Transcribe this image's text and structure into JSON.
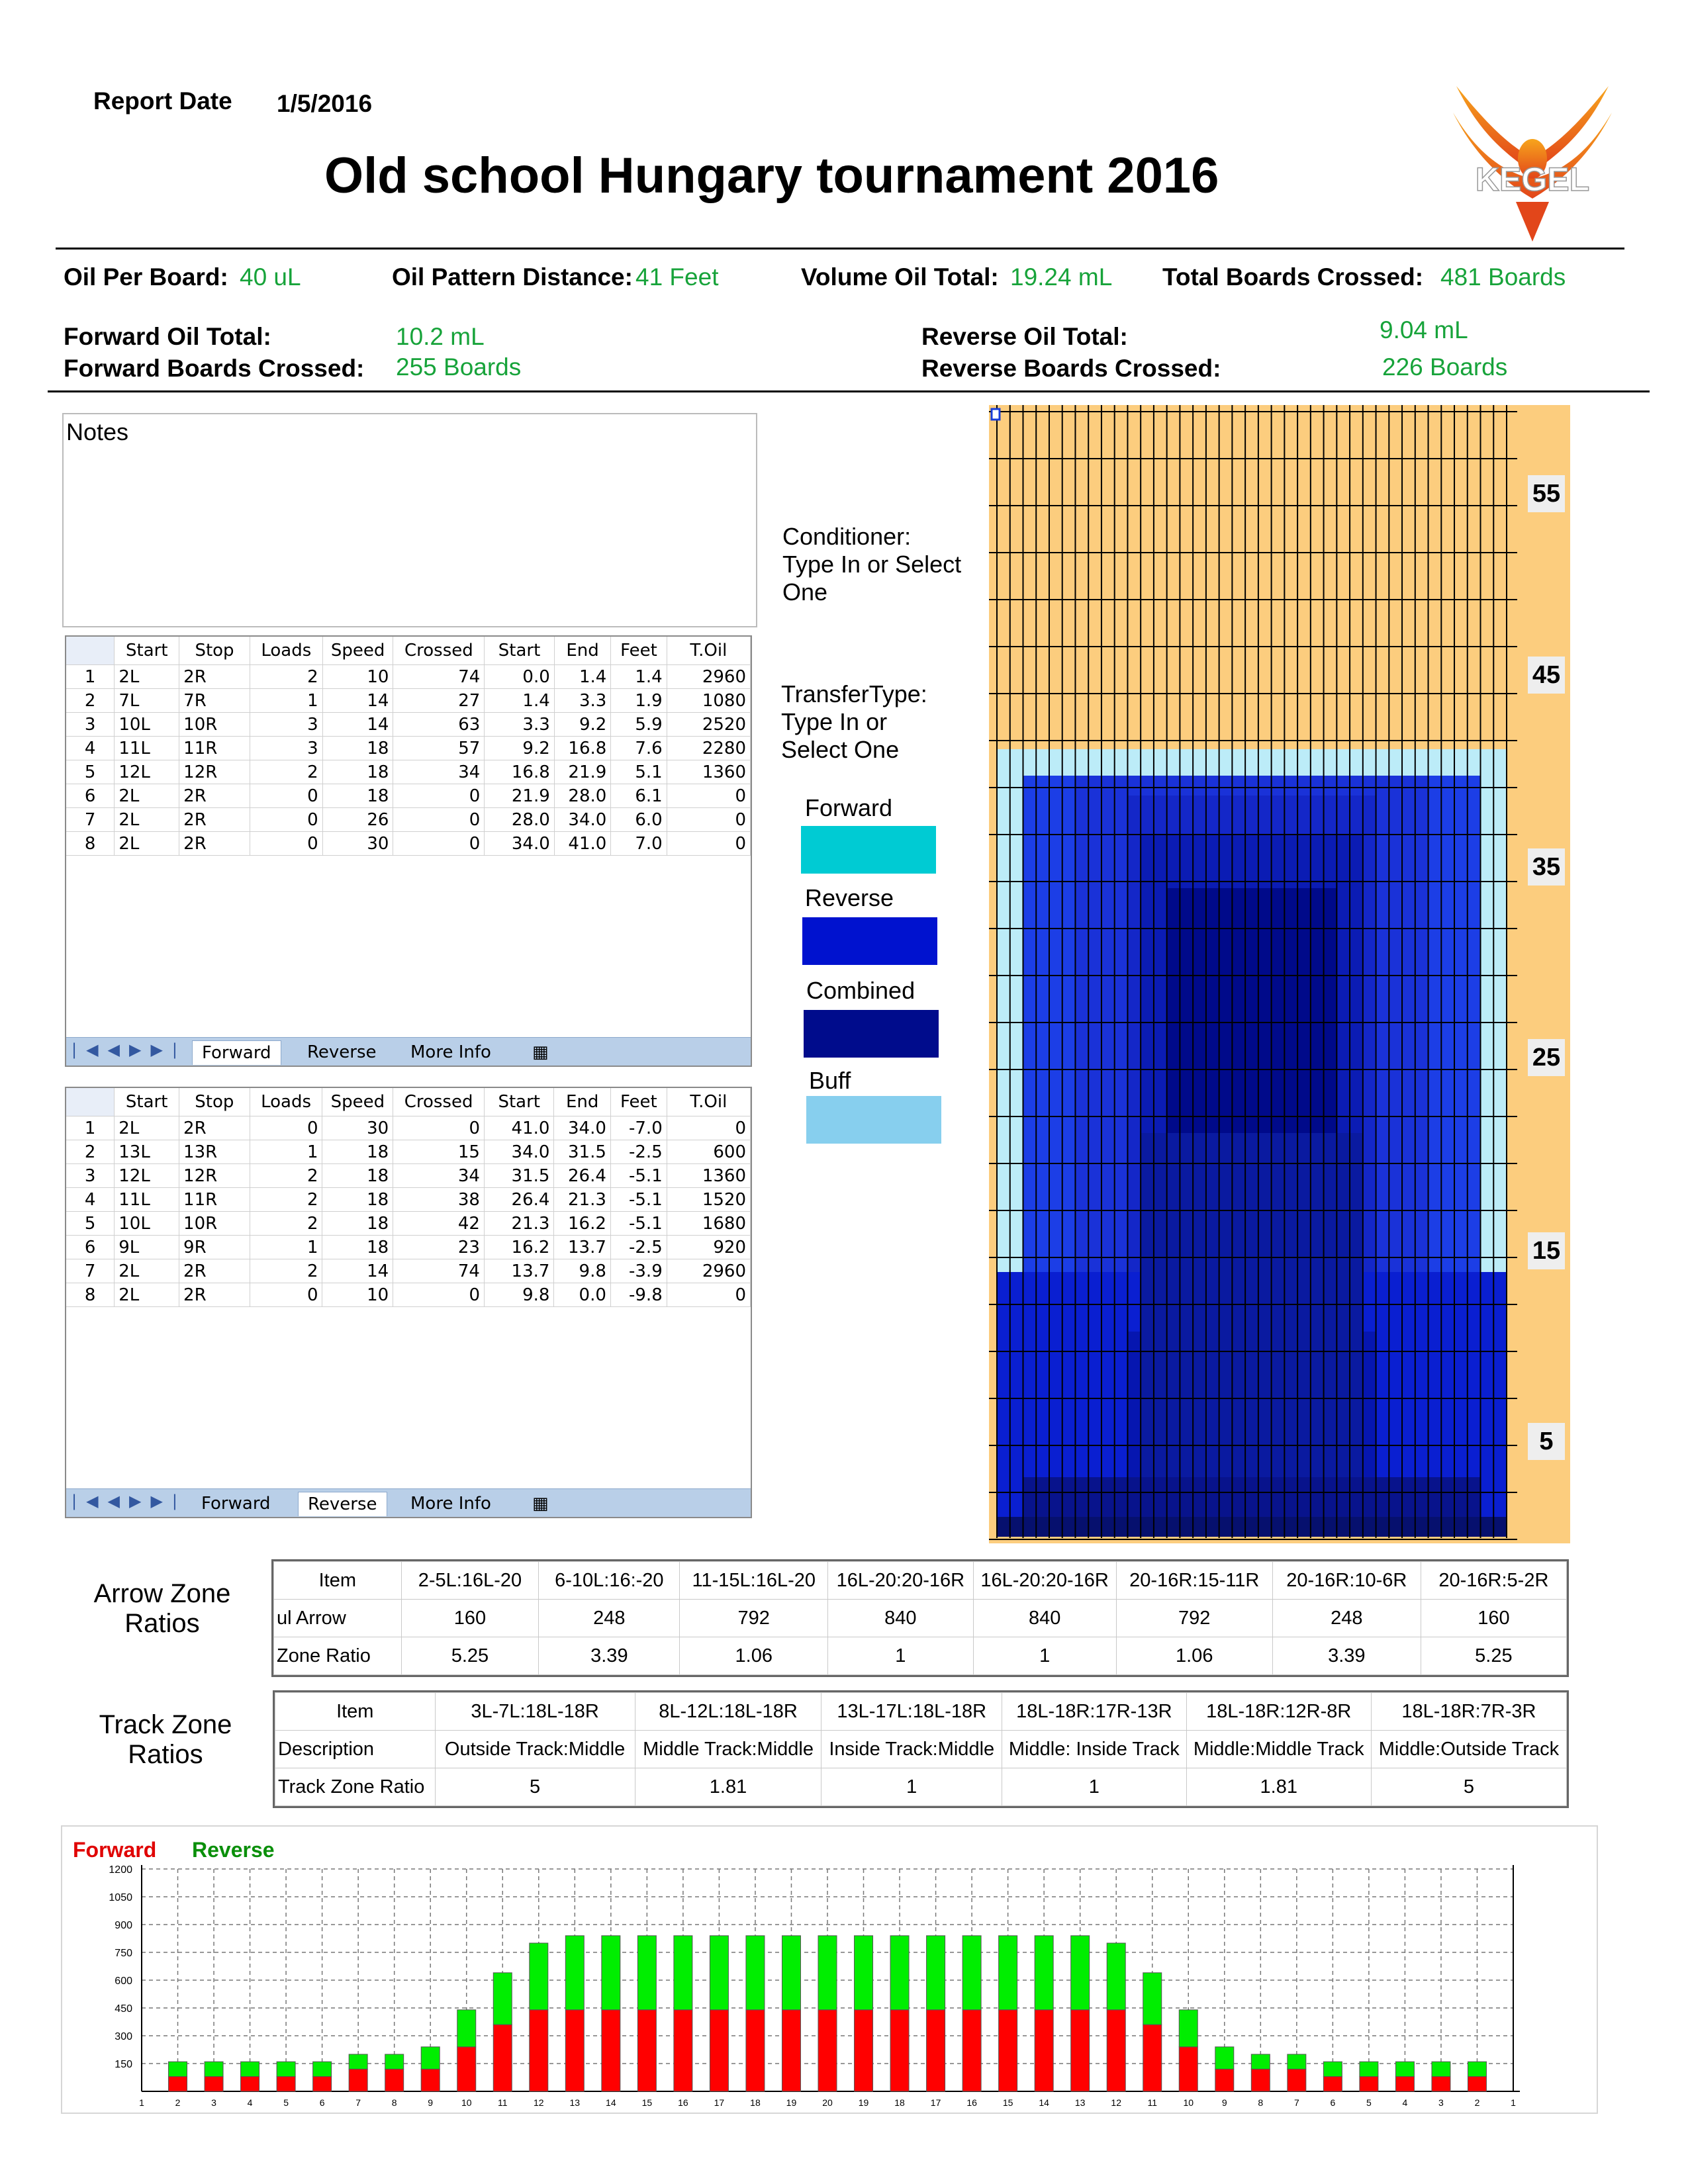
{
  "header": {
    "report_date_label": "Report Date",
    "report_date": "1/5/2016",
    "title": "Old school Hungary tournament 2016",
    "logo_text": "KEGEL"
  },
  "summary": {
    "oil_per_board_label": "Oil Per Board:",
    "oil_per_board": "40 uL",
    "pattern_distance_label": "Oil Pattern Distance:",
    "pattern_distance": "41 Feet",
    "volume_label": "Volume Oil Total:",
    "volume": "19.24 mL",
    "boards_crossed_label": "Total Boards Crossed:",
    "boards_crossed": "481 Boards",
    "fwd_oil_label": "Forward Oil Total:",
    "fwd_oil": "10.2 mL",
    "fwd_boards_label": "Forward Boards Crossed:",
    "fwd_boards": "255 Boards",
    "rev_oil_label": "Reverse Oil Total:",
    "rev_oil": "9.04 mL",
    "rev_boards_label": "Reverse Boards Crossed:",
    "rev_boards": "226 Boards"
  },
  "notes_label": "Notes",
  "conditioner_text": [
    "Conditioner:",
    "Type In or Select",
    "One"
  ],
  "transfer_text": [
    "TransferType:",
    "Type In or",
    "Select One"
  ],
  "legend": [
    {
      "label": "Forward",
      "color": "#00cbd3"
    },
    {
      "label": "Reverse",
      "color": "#0012cf"
    },
    {
      "label": "Combined",
      "color": "#000c8c"
    },
    {
      "label": "Buff",
      "color": "#87cfee"
    }
  ],
  "columns": [
    "Start",
    "Stop",
    "Loads",
    "Speed",
    "Crossed",
    "Start",
    "End",
    "Feet",
    "T.Oil"
  ],
  "tabs": [
    "Forward",
    "Reverse",
    "More Info"
  ],
  "forward_rows": [
    [
      "1",
      "2L",
      "2R",
      "2",
      "10",
      "74",
      "0.0",
      "1.4",
      "1.4",
      "2960"
    ],
    [
      "2",
      "7L",
      "7R",
      "1",
      "14",
      "27",
      "1.4",
      "3.3",
      "1.9",
      "1080"
    ],
    [
      "3",
      "10L",
      "10R",
      "3",
      "14",
      "63",
      "3.3",
      "9.2",
      "5.9",
      "2520"
    ],
    [
      "4",
      "11L",
      "11R",
      "3",
      "18",
      "57",
      "9.2",
      "16.8",
      "7.6",
      "2280"
    ],
    [
      "5",
      "12L",
      "12R",
      "2",
      "18",
      "34",
      "16.8",
      "21.9",
      "5.1",
      "1360"
    ],
    [
      "6",
      "2L",
      "2R",
      "0",
      "18",
      "0",
      "21.9",
      "28.0",
      "6.1",
      "0"
    ],
    [
      "7",
      "2L",
      "2R",
      "0",
      "26",
      "0",
      "28.0",
      "34.0",
      "6.0",
      "0"
    ],
    [
      "8",
      "2L",
      "2R",
      "0",
      "30",
      "0",
      "34.0",
      "41.0",
      "7.0",
      "0"
    ]
  ],
  "reverse_rows": [
    [
      "1",
      "2L",
      "2R",
      "0",
      "30",
      "0",
      "41.0",
      "34.0",
      "-7.0",
      "0"
    ],
    [
      "2",
      "13L",
      "13R",
      "1",
      "18",
      "15",
      "34.0",
      "31.5",
      "-2.5",
      "600"
    ],
    [
      "3",
      "12L",
      "12R",
      "2",
      "18",
      "34",
      "31.5",
      "26.4",
      "-5.1",
      "1360"
    ],
    [
      "4",
      "11L",
      "11R",
      "2",
      "18",
      "38",
      "26.4",
      "21.3",
      "-5.1",
      "1520"
    ],
    [
      "5",
      "10L",
      "10R",
      "2",
      "18",
      "42",
      "21.3",
      "16.2",
      "-5.1",
      "1680"
    ],
    [
      "6",
      "9L",
      "9R",
      "1",
      "18",
      "23",
      "16.2",
      "13.7",
      "-2.5",
      "920"
    ],
    [
      "7",
      "2L",
      "2R",
      "2",
      "14",
      "74",
      "13.7",
      "9.8",
      "-3.9",
      "2960"
    ],
    [
      "8",
      "2L",
      "2R",
      "0",
      "10",
      "0",
      "9.8",
      "0.0",
      "-9.8",
      "0"
    ]
  ],
  "oil_graph": {
    "ruler_labels": [
      "55",
      "45",
      "35",
      "25",
      "15",
      "5"
    ],
    "colors": {
      "background": "#fccd7e",
      "buff": "#bcecf8",
      "reverse": "#0a1fd1",
      "combined": "#000a8a"
    }
  },
  "arrow_zone": {
    "title": [
      "Arrow Zone",
      "Ratios"
    ],
    "headers": [
      "Item",
      "2-5L:16L-20",
      "6-10L:16:-20",
      "11-15L:16L-20",
      "16L-20:20-16R",
      "16L-20:20-16R",
      "20-16R:15-11R",
      "20-16R:10-6R",
      "20-16R:5-2R"
    ],
    "rows": [
      [
        "ul Arrow",
        "160",
        "248",
        "792",
        "840",
        "840",
        "792",
        "248",
        "160"
      ],
      [
        "Zone Ratio",
        "5.25",
        "3.39",
        "1.06",
        "1",
        "1",
        "1.06",
        "3.39",
        "5.25"
      ]
    ]
  },
  "track_zone": {
    "title": [
      "Track Zone",
      "Ratios"
    ],
    "headers": [
      "Item",
      "3L-7L:18L-18R",
      "8L-12L:18L-18R",
      "13L-17L:18L-18R",
      "18L-18R:17R-13R",
      "18L-18R:12R-8R",
      "18L-18R:7R-3R"
    ],
    "rows": [
      [
        "Description",
        "Outside Track:Middle",
        "Middle Track:Middle",
        "Inside Track:Middle",
        "Middle: Inside Track",
        "Middle:Middle Track",
        "Middle:Outside Track"
      ],
      [
        "Track Zone Ratio",
        "5",
        "1.81",
        "1",
        "1",
        "1.81",
        "5"
      ]
    ]
  },
  "chart_data": {
    "type": "bar",
    "legend": [
      {
        "name": "Forward",
        "color": "#e00000"
      },
      {
        "name": "Reverse",
        "color": "#0a8f0a"
      }
    ],
    "categories": [
      "1",
      "2",
      "3",
      "4",
      "5",
      "6",
      "7",
      "8",
      "9",
      "10",
      "11",
      "12",
      "13",
      "14",
      "15",
      "16",
      "17",
      "18",
      "19",
      "20",
      "19",
      "18",
      "17",
      "16",
      "15",
      "14",
      "13",
      "12",
      "11",
      "10",
      "9",
      "8",
      "7",
      "6",
      "5",
      "4",
      "3",
      "2",
      "1"
    ],
    "series": [
      {
        "name": "Forward",
        "color": "#ff0000",
        "values": [
          0,
          80,
          80,
          80,
          80,
          80,
          120,
          120,
          120,
          240,
          360,
          440,
          440,
          440,
          440,
          440,
          440,
          440,
          440,
          440,
          440,
          440,
          440,
          440,
          440,
          440,
          440,
          440,
          360,
          240,
          120,
          120,
          120,
          80,
          80,
          80,
          80,
          80,
          0
        ]
      },
      {
        "name": "Reverse",
        "color": "#00ee00",
        "values": [
          0,
          80,
          80,
          80,
          80,
          80,
          80,
          80,
          120,
          200,
          280,
          360,
          400,
          400,
          400,
          400,
          400,
          400,
          400,
          400,
          400,
          400,
          400,
          400,
          400,
          400,
          400,
          360,
          280,
          200,
          120,
          80,
          80,
          80,
          80,
          80,
          80,
          80,
          0
        ]
      }
    ],
    "yticks": [
      "150",
      "300",
      "450",
      "600",
      "750",
      "900",
      "1050",
      "1200"
    ],
    "ylim": [
      0,
      1200
    ]
  }
}
